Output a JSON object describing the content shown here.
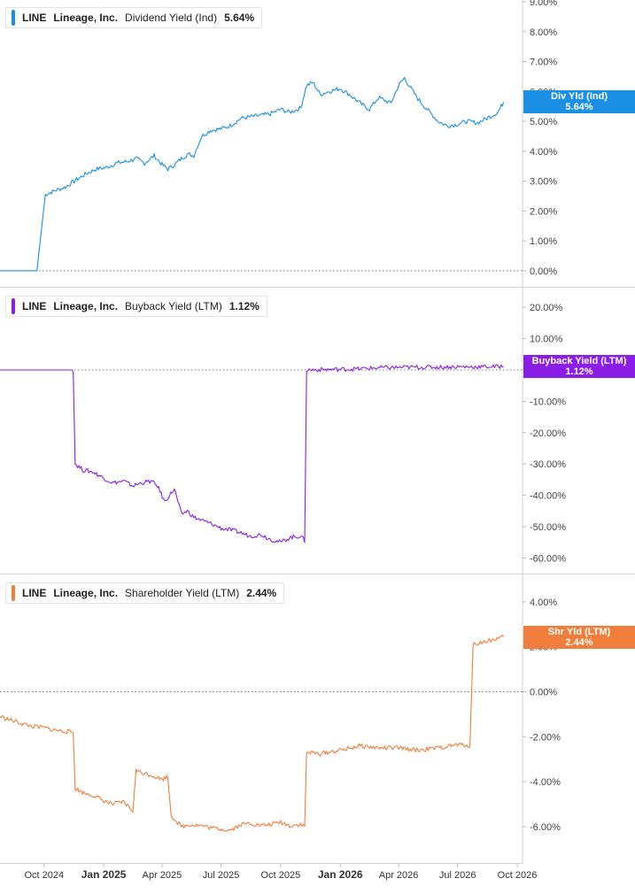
{
  "chart_data": [
    {
      "type": "line",
      "panel": 1,
      "ticker": "LINE",
      "company": "Lineage, Inc.",
      "metric": "Dividend Yield (Ind)",
      "last_value_label": "5.64%",
      "tag_line1": "Div Yld (Ind)",
      "tag_line2": "5.64%",
      "color": "#1a8fe3",
      "y_unit": "%",
      "ylim": [
        -0.3,
        9.0
      ],
      "y_ticks": [
        9,
        8,
        7,
        6,
        5,
        4,
        3,
        2,
        1,
        0
      ],
      "y_tick_labels": [
        "9.00%",
        "8.00%",
        "7.00%",
        "6.00%",
        "5.00%",
        "4.00%",
        "3.00%",
        "2.00%",
        "1.00%",
        "0.00%"
      ],
      "x": [
        "2024-07-25",
        "2024-08-22",
        "2024-09-20",
        "2024-10-03",
        "2024-10-20",
        "2024-11-03",
        "2024-11-20",
        "2024-12-05",
        "2024-12-20",
        "2025-01-05",
        "2025-01-20",
        "2025-02-05",
        "2025-02-20",
        "2025-03-05",
        "2025-03-20",
        "2025-04-01",
        "2025-04-10",
        "2025-04-20",
        "2025-05-01",
        "2025-05-10",
        "2025-05-20",
        "2025-06-01",
        "2025-06-15",
        "2025-07-01",
        "2025-07-15",
        "2025-08-01",
        "2025-08-15",
        "2025-09-01",
        "2025-09-15",
        "2025-10-01",
        "2025-10-15",
        "2025-11-01",
        "2025-11-10",
        "2025-11-20",
        "2025-12-01",
        "2025-12-15",
        "2026-01-01",
        "2026-01-15",
        "2026-02-01",
        "2026-02-15",
        "2026-03-01",
        "2026-03-20",
        "2026-04-01",
        "2026-04-10",
        "2026-04-20",
        "2026-05-01",
        "2026-05-15",
        "2026-06-01",
        "2026-06-15",
        "2026-07-01",
        "2026-07-15",
        "2026-08-01",
        "2026-08-15",
        "2026-09-01",
        "2026-09-10"
      ],
      "values": [
        0.0,
        0.0,
        0.0,
        2.55,
        2.7,
        2.8,
        3.05,
        3.25,
        3.4,
        3.45,
        3.6,
        3.65,
        3.75,
        3.6,
        3.85,
        3.55,
        3.4,
        3.55,
        3.75,
        3.9,
        3.85,
        4.5,
        4.7,
        4.75,
        4.85,
        5.1,
        5.15,
        5.2,
        5.25,
        5.4,
        5.3,
        5.45,
        6.2,
        6.3,
        5.9,
        6.0,
        6.1,
        5.9,
        5.6,
        5.4,
        5.8,
        5.6,
        6.2,
        6.45,
        6.1,
        5.75,
        5.4,
        5.0,
        4.85,
        4.9,
        5.0,
        4.95,
        5.1,
        5.3,
        5.64
      ]
    },
    {
      "type": "line",
      "panel": 2,
      "ticker": "LINE",
      "company": "Lineage, Inc.",
      "metric": "Buyback Yield (LTM)",
      "last_value_label": "1.12%",
      "tag_line1": "Buyback Yield (LTM)",
      "tag_line2": "1.12%",
      "color": "#8a1ee6",
      "y_unit": "%",
      "ylim": [
        -63,
        24
      ],
      "y_ticks": [
        20,
        10,
        -10,
        -20,
        -30,
        -40,
        -50,
        -60
      ],
      "y_tick_labels": [
        "20.00%",
        "10.00%",
        "-10.00%",
        "-20.00%",
        "-30.00%",
        "-40.00%",
        "-50.00%",
        "-60.00%"
      ],
      "x": [
        "2024-07-25",
        "2024-10-01",
        "2024-11-15",
        "2024-11-18",
        "2024-12-01",
        "2024-12-15",
        "2025-01-01",
        "2025-01-15",
        "2025-02-01",
        "2025-02-15",
        "2025-03-01",
        "2025-03-15",
        "2025-03-25",
        "2025-04-05",
        "2025-04-20",
        "2025-05-01",
        "2025-05-10",
        "2025-05-20",
        "2025-06-01",
        "2025-06-15",
        "2025-07-01",
        "2025-07-15",
        "2025-08-01",
        "2025-08-15",
        "2025-09-01",
        "2025-09-15",
        "2025-10-01",
        "2025-10-15",
        "2025-11-01",
        "2025-11-07",
        "2025-11-10",
        "2025-12-01",
        "2026-01-01",
        "2026-02-01",
        "2026-03-01",
        "2026-04-01",
        "2026-05-01",
        "2026-06-01",
        "2026-07-01",
        "2026-08-01",
        "2026-09-10"
      ],
      "values": [
        0.0,
        0.0,
        0.0,
        -30.0,
        -32.0,
        -32.5,
        -34.5,
        -36.0,
        -35.5,
        -37.0,
        -36.0,
        -35.5,
        -37.0,
        -42.0,
        -38.0,
        -46.0,
        -45.0,
        -47.0,
        -48.0,
        -49.0,
        -50.5,
        -51.0,
        -52.0,
        -53.0,
        -52.5,
        -54.0,
        -55.0,
        -53.5,
        -53.0,
        -54.5,
        0.0,
        0.1,
        0.2,
        0.4,
        0.7,
        0.8,
        0.9,
        0.9,
        1.0,
        1.0,
        1.12
      ]
    },
    {
      "type": "line",
      "panel": 3,
      "ticker": "LINE",
      "company": "Lineage, Inc.",
      "metric": "Shareholder Yield (LTM)",
      "last_value_label": "2.44%",
      "tag_line1": "Shr Yld (LTM)",
      "tag_line2": "2.44%",
      "color": "#f07d3c",
      "y_unit": "%",
      "ylim": [
        -7.3,
        4.9
      ],
      "y_ticks": [
        4,
        2,
        0,
        -2,
        -4,
        -6
      ],
      "y_tick_labels": [
        "4.00%",
        "2.00%",
        "0.00%",
        "-2.00%",
        "-4.00%",
        "-6.00%"
      ],
      "x": [
        "2024-07-25",
        "2024-08-15",
        "2024-09-01",
        "2024-09-15",
        "2024-10-01",
        "2024-10-15",
        "2024-11-01",
        "2024-11-15",
        "2024-11-18",
        "2024-12-01",
        "2024-12-15",
        "2025-01-01",
        "2025-01-15",
        "2025-02-01",
        "2025-02-15",
        "2025-02-20",
        "2025-03-01",
        "2025-03-15",
        "2025-04-01",
        "2025-04-10",
        "2025-04-15",
        "2025-05-01",
        "2025-05-15",
        "2025-06-01",
        "2025-06-15",
        "2025-07-01",
        "2025-07-15",
        "2025-08-01",
        "2025-08-15",
        "2025-09-01",
        "2025-09-15",
        "2025-10-01",
        "2025-10-15",
        "2025-11-01",
        "2025-11-07",
        "2025-11-10",
        "2025-12-01",
        "2026-01-01",
        "2026-02-01",
        "2026-03-01",
        "2026-04-01",
        "2026-05-01",
        "2026-06-01",
        "2026-07-01",
        "2026-07-20",
        "2026-07-25",
        "2026-08-15",
        "2026-09-10"
      ],
      "values": [
        -1.1,
        -1.3,
        -1.45,
        -1.55,
        -1.6,
        -1.7,
        -1.75,
        -1.8,
        -4.3,
        -4.5,
        -4.6,
        -4.85,
        -5.0,
        -4.9,
        -5.3,
        -3.5,
        -3.6,
        -3.7,
        -3.9,
        -3.75,
        -5.5,
        -6.0,
        -5.9,
        -5.95,
        -6.05,
        -6.1,
        -6.15,
        -5.9,
        -5.85,
        -5.95,
        -5.9,
        -5.8,
        -5.95,
        -5.9,
        -6.0,
        -2.7,
        -2.75,
        -2.6,
        -2.4,
        -2.5,
        -2.5,
        -2.6,
        -2.5,
        -2.35,
        -2.4,
        2.1,
        2.25,
        2.44
      ]
    }
  ],
  "x_axis": {
    "ticks": [
      "2024-10-01",
      "2025-01-01",
      "2025-04-01",
      "2025-07-01",
      "2025-10-01",
      "2026-01-01",
      "2026-04-01",
      "2026-07-01",
      "2026-10-01"
    ],
    "labels": [
      "Oct 2024",
      "Jan 2025",
      "Apr 2025",
      "Jul 2025",
      "Oct 2025",
      "Jan 2026",
      "Apr 2026",
      "Jul 2026",
      "Oct 2026"
    ],
    "bold": [
      false,
      true,
      false,
      false,
      false,
      true,
      false,
      false,
      false
    ]
  }
}
